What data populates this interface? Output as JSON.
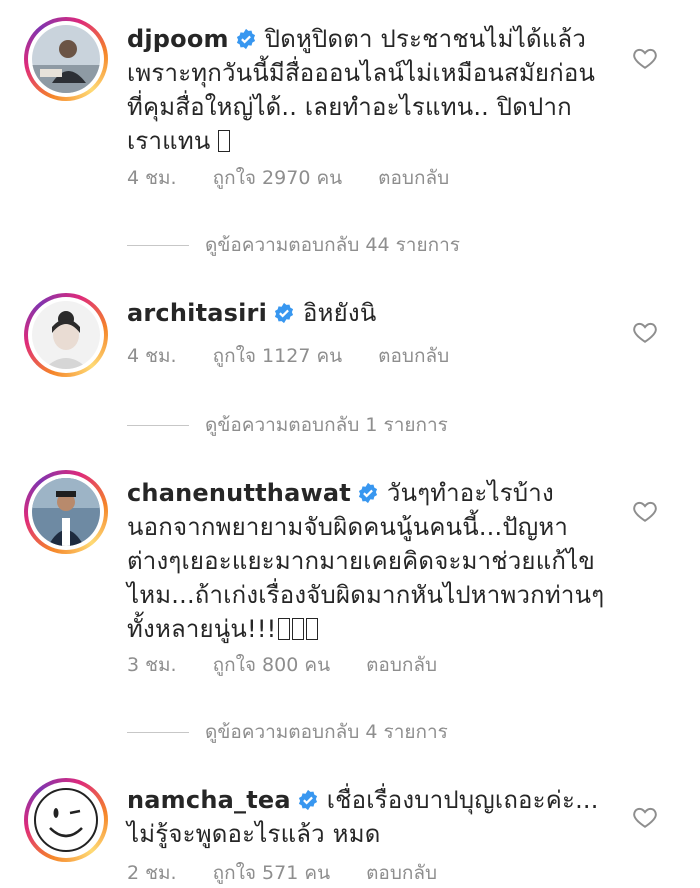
{
  "comments": [
    {
      "username": "djpoom",
      "text": "ปิดหูปิดตา ประชาชนไม่ได้แล้ว เพราะทุกวันนี้มีสื่อออนไลน์ไม่เหมือนสมัยก่อนที่คุมสื่อใหญ่ได้.. เลยทำอะไรแทน.. ปิดปากเราแทน ",
      "time": "4 ชม.",
      "likes": "ถูกใจ 2970 คน",
      "reply": "ตอบกลับ",
      "view_replies": "ดูข้อความตอบกลับ 44 รายการ"
    },
    {
      "username": "architasiri",
      "text": "อิหยังนิ",
      "time": "4 ชม.",
      "likes": "ถูกใจ 1127 คน",
      "reply": "ตอบกลับ",
      "view_replies": "ดูข้อความตอบกลับ 1 รายการ"
    },
    {
      "username": "chanenutthawat",
      "text": "วันๆทำอะไรบ้าง นอกจากพยายามจับผิดคนนู้นคนนี้...ปัญหาต่างๆเยอะแยะมากมายเคยคิดจะมาช่วยแก้ไขไหม...ถ้าเก่งเรื่องจับผิดมากหันไปหาพวกท่านๆทั้งหลายนู่น!!!",
      "time": "3 ชม.",
      "likes": "ถูกใจ 800 คน",
      "reply": "ตอบกลับ",
      "view_replies": "ดูข้อความตอบกลับ 4 รายการ"
    },
    {
      "username": "namcha_tea",
      "text": "เชื่อเรื่องบาปบุญเถอะค่ะ... ไม่รู้จะพูดอะไรแล้ว หมด",
      "time": "2 ชม.",
      "likes": "ถูกใจ 571 คน",
      "reply": "ตอบกลับ"
    }
  ],
  "icons": {
    "verified": "verified-badge-icon",
    "like": "heart-outline-icon"
  },
  "colors": {
    "verified_blue": "#3897f0",
    "meta_gray": "#8e8e8e"
  }
}
